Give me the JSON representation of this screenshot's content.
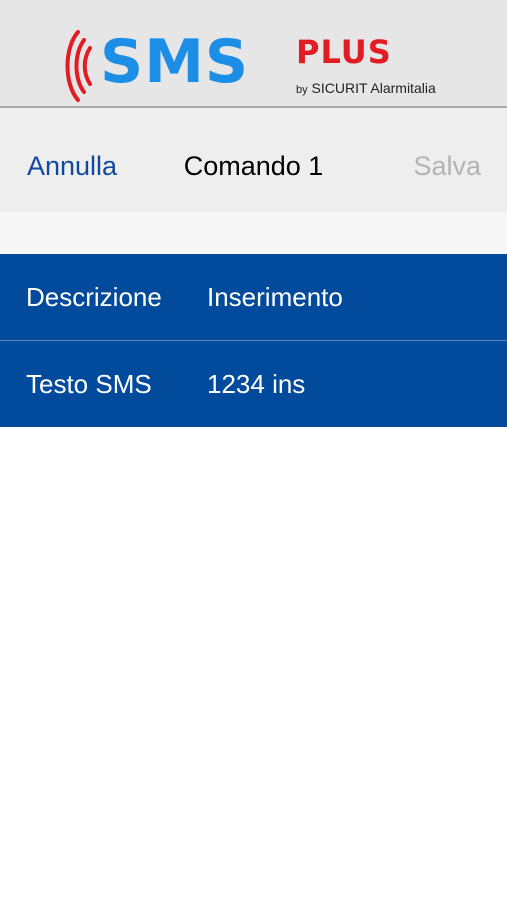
{
  "logo": {
    "sms": "SMS",
    "plus": "PLUS",
    "by": "by",
    "company": "SICURIT Alarmitalia",
    "brand_blue": "#1c8ee6",
    "brand_red": "#e31b23"
  },
  "nav": {
    "cancel_label": "Annulla",
    "title": "Comando 1",
    "save_label": "Salva",
    "accent": "#114a9c",
    "disabled": "#b4b4b4"
  },
  "form": {
    "row_color": "#024a9c",
    "rows": [
      {
        "label": "Descrizione",
        "value": "Inserimento"
      },
      {
        "label": "Testo SMS",
        "value": "1234 ins"
      }
    ]
  }
}
